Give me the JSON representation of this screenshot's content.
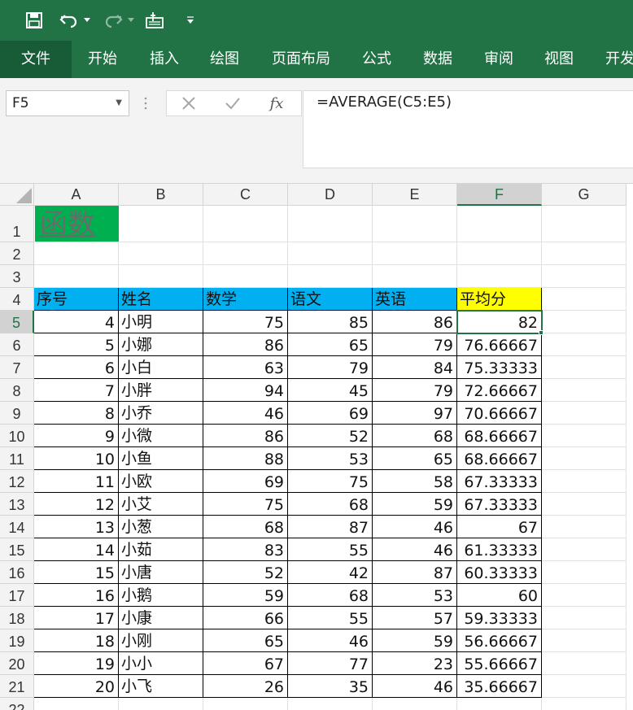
{
  "qat": {
    "icons": [
      "save-icon",
      "undo-icon",
      "dropdown-icon",
      "redo-icon",
      "dropdown-icon",
      "touch-mode-icon",
      "customize-icon"
    ]
  },
  "ribbon": {
    "tabs": [
      "文件",
      "开始",
      "插入",
      "绘图",
      "页面布局",
      "公式",
      "数据",
      "审阅",
      "视图",
      "开发"
    ]
  },
  "formula_bar": {
    "name_box": "F5",
    "formula": "=AVERAGE(C5:E5)",
    "fx_label": "fx"
  },
  "grid": {
    "columns": [
      "A",
      "B",
      "C",
      "D",
      "E",
      "F",
      "G"
    ],
    "selected_column": "F",
    "rows": [
      "1",
      "2",
      "3",
      "4",
      "5",
      "6",
      "7",
      "8",
      "9",
      "10",
      "11",
      "12",
      "13",
      "14",
      "15",
      "16",
      "17",
      "18",
      "19",
      "20",
      "21",
      "22"
    ],
    "selected_row": "5",
    "title_text": "函数",
    "headers": [
      "序号",
      "姓名",
      "数学",
      "语文",
      "英语",
      "平均分"
    ],
    "data": [
      [
        "4",
        "小明",
        "75",
        "85",
        "86",
        "82"
      ],
      [
        "5",
        "小娜",
        "86",
        "65",
        "79",
        "76.66667"
      ],
      [
        "6",
        "小白",
        "63",
        "79",
        "84",
        "75.33333"
      ],
      [
        "7",
        "小胖",
        "94",
        "45",
        "79",
        "72.66667"
      ],
      [
        "8",
        "小乔",
        "46",
        "69",
        "97",
        "70.66667"
      ],
      [
        "9",
        "小微",
        "86",
        "52",
        "68",
        "68.66667"
      ],
      [
        "10",
        "小鱼",
        "88",
        "53",
        "65",
        "68.66667"
      ],
      [
        "11",
        " 小欧",
        "69",
        "75",
        "58",
        "67.33333"
      ],
      [
        "12",
        "小艾",
        "75",
        "68",
        "59",
        "67.33333"
      ],
      [
        "13",
        "小葱",
        "68",
        "87",
        "46",
        "67"
      ],
      [
        "14",
        "小茹",
        "83",
        "55",
        "46",
        "61.33333"
      ],
      [
        "15",
        "小唐",
        "52",
        "42",
        "87",
        "60.33333"
      ],
      [
        "16",
        "小鹅",
        "59",
        "68",
        "53",
        "60"
      ],
      [
        "17",
        "小康",
        "66",
        "55",
        "57",
        "59.33333"
      ],
      [
        "18",
        "小刚",
        "65",
        "46",
        "59",
        "56.66667"
      ],
      [
        "19",
        "小小",
        "67",
        "77",
        "23",
        "55.66667"
      ],
      [
        "20",
        "小飞",
        "26",
        "35",
        "46",
        "35.66667"
      ]
    ],
    "colors": {
      "header_blue": "#00b0f0",
      "header_yellow": "#ffff00",
      "title_green": "#00b050",
      "excel_green": "#217346"
    }
  }
}
